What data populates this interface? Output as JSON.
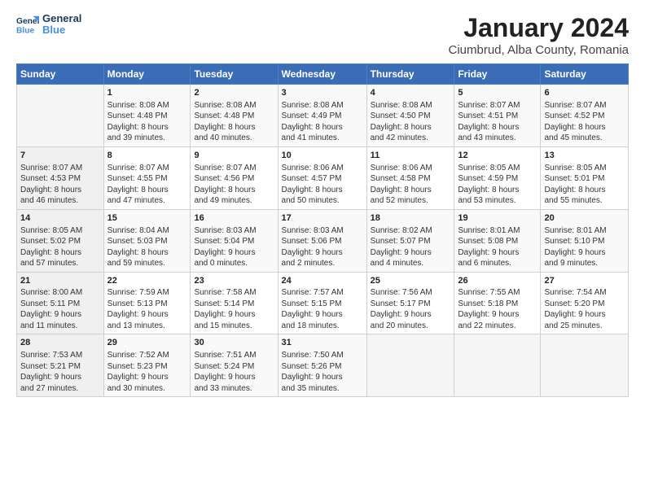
{
  "app": {
    "logo_general": "General",
    "logo_blue": "Blue",
    "title": "January 2024",
    "subtitle": "Ciumbrud, Alba County, Romania"
  },
  "calendar": {
    "headers": [
      "Sunday",
      "Monday",
      "Tuesday",
      "Wednesday",
      "Thursday",
      "Friday",
      "Saturday"
    ],
    "weeks": [
      [
        {
          "day": "",
          "info": ""
        },
        {
          "day": "1",
          "info": "Sunrise: 8:08 AM\nSunset: 4:48 PM\nDaylight: 8 hours\nand 39 minutes."
        },
        {
          "day": "2",
          "info": "Sunrise: 8:08 AM\nSunset: 4:48 PM\nDaylight: 8 hours\nand 40 minutes."
        },
        {
          "day": "3",
          "info": "Sunrise: 8:08 AM\nSunset: 4:49 PM\nDaylight: 8 hours\nand 41 minutes."
        },
        {
          "day": "4",
          "info": "Sunrise: 8:08 AM\nSunset: 4:50 PM\nDaylight: 8 hours\nand 42 minutes."
        },
        {
          "day": "5",
          "info": "Sunrise: 8:07 AM\nSunset: 4:51 PM\nDaylight: 8 hours\nand 43 minutes."
        },
        {
          "day": "6",
          "info": "Sunrise: 8:07 AM\nSunset: 4:52 PM\nDaylight: 8 hours\nand 45 minutes."
        }
      ],
      [
        {
          "day": "7",
          "info": "Sunrise: 8:07 AM\nSunset: 4:53 PM\nDaylight: 8 hours\nand 46 minutes."
        },
        {
          "day": "8",
          "info": "Sunrise: 8:07 AM\nSunset: 4:55 PM\nDaylight: 8 hours\nand 47 minutes."
        },
        {
          "day": "9",
          "info": "Sunrise: 8:07 AM\nSunset: 4:56 PM\nDaylight: 8 hours\nand 49 minutes."
        },
        {
          "day": "10",
          "info": "Sunrise: 8:06 AM\nSunset: 4:57 PM\nDaylight: 8 hours\nand 50 minutes."
        },
        {
          "day": "11",
          "info": "Sunrise: 8:06 AM\nSunset: 4:58 PM\nDaylight: 8 hours\nand 52 minutes."
        },
        {
          "day": "12",
          "info": "Sunrise: 8:05 AM\nSunset: 4:59 PM\nDaylight: 8 hours\nand 53 minutes."
        },
        {
          "day": "13",
          "info": "Sunrise: 8:05 AM\nSunset: 5:01 PM\nDaylight: 8 hours\nand 55 minutes."
        }
      ],
      [
        {
          "day": "14",
          "info": "Sunrise: 8:05 AM\nSunset: 5:02 PM\nDaylight: 8 hours\nand 57 minutes."
        },
        {
          "day": "15",
          "info": "Sunrise: 8:04 AM\nSunset: 5:03 PM\nDaylight: 8 hours\nand 59 minutes."
        },
        {
          "day": "16",
          "info": "Sunrise: 8:03 AM\nSunset: 5:04 PM\nDaylight: 9 hours\nand 0 minutes."
        },
        {
          "day": "17",
          "info": "Sunrise: 8:03 AM\nSunset: 5:06 PM\nDaylight: 9 hours\nand 2 minutes."
        },
        {
          "day": "18",
          "info": "Sunrise: 8:02 AM\nSunset: 5:07 PM\nDaylight: 9 hours\nand 4 minutes."
        },
        {
          "day": "19",
          "info": "Sunrise: 8:01 AM\nSunset: 5:08 PM\nDaylight: 9 hours\nand 6 minutes."
        },
        {
          "day": "20",
          "info": "Sunrise: 8:01 AM\nSunset: 5:10 PM\nDaylight: 9 hours\nand 9 minutes."
        }
      ],
      [
        {
          "day": "21",
          "info": "Sunrise: 8:00 AM\nSunset: 5:11 PM\nDaylight: 9 hours\nand 11 minutes."
        },
        {
          "day": "22",
          "info": "Sunrise: 7:59 AM\nSunset: 5:13 PM\nDaylight: 9 hours\nand 13 minutes."
        },
        {
          "day": "23",
          "info": "Sunrise: 7:58 AM\nSunset: 5:14 PM\nDaylight: 9 hours\nand 15 minutes."
        },
        {
          "day": "24",
          "info": "Sunrise: 7:57 AM\nSunset: 5:15 PM\nDaylight: 9 hours\nand 18 minutes."
        },
        {
          "day": "25",
          "info": "Sunrise: 7:56 AM\nSunset: 5:17 PM\nDaylight: 9 hours\nand 20 minutes."
        },
        {
          "day": "26",
          "info": "Sunrise: 7:55 AM\nSunset: 5:18 PM\nDaylight: 9 hours\nand 22 minutes."
        },
        {
          "day": "27",
          "info": "Sunrise: 7:54 AM\nSunset: 5:20 PM\nDaylight: 9 hours\nand 25 minutes."
        }
      ],
      [
        {
          "day": "28",
          "info": "Sunrise: 7:53 AM\nSunset: 5:21 PM\nDaylight: 9 hours\nand 27 minutes."
        },
        {
          "day": "29",
          "info": "Sunrise: 7:52 AM\nSunset: 5:23 PM\nDaylight: 9 hours\nand 30 minutes."
        },
        {
          "day": "30",
          "info": "Sunrise: 7:51 AM\nSunset: 5:24 PM\nDaylight: 9 hours\nand 33 minutes."
        },
        {
          "day": "31",
          "info": "Sunrise: 7:50 AM\nSunset: 5:26 PM\nDaylight: 9 hours\nand 35 minutes."
        },
        {
          "day": "",
          "info": ""
        },
        {
          "day": "",
          "info": ""
        },
        {
          "day": "",
          "info": ""
        }
      ]
    ]
  }
}
